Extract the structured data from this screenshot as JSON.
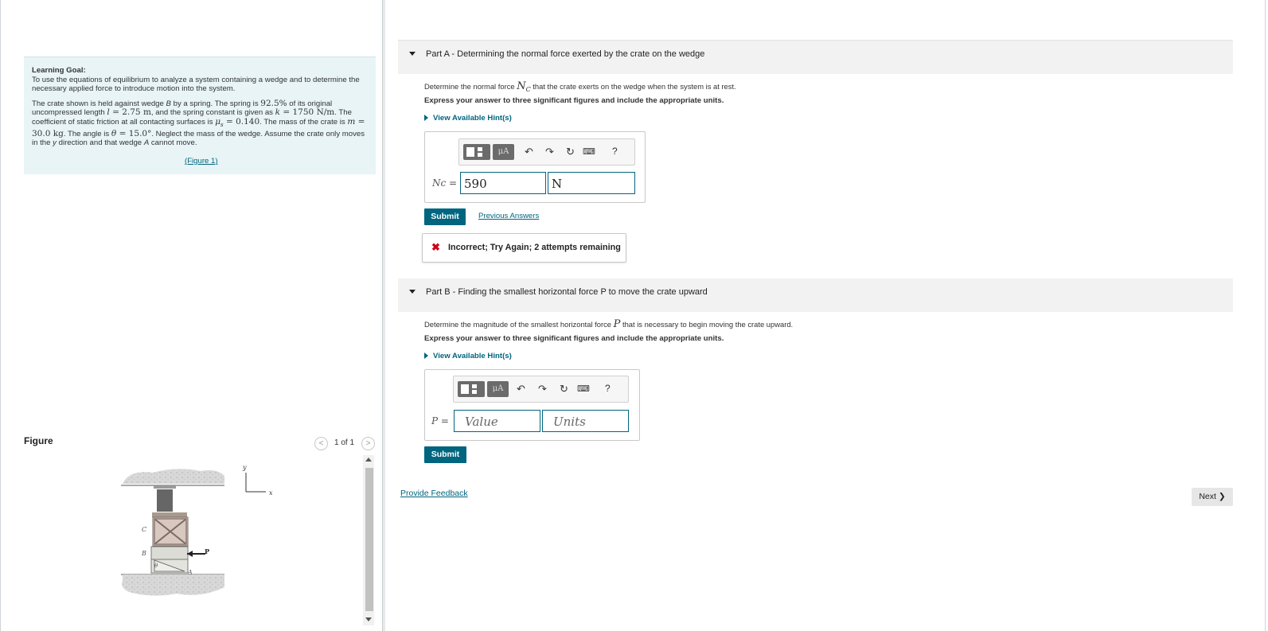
{
  "learning_goal": {
    "title": "Learning Goal:",
    "text": "To use the equations of equilibrium to analyze a system containing a wedge and to determine the necessary applied force to introduce motion into the system.",
    "p1": "The crate shown is held against wedge ",
    "b_label": "B",
    "p2": " by a spring. The spring is ",
    "pct": "92.5%",
    "p3": " of its original uncompressed length ",
    "l_sym": "l",
    "l_val": " = 2.75 m",
    "p4": ", and the spring constant is given as ",
    "k_sym": "k",
    "k_val": " = 1750 N/m",
    "p5": ". The coefficient of static friction at all contacting surfaces is ",
    "mu_sym": "μ",
    "mu_sub": "s",
    "mu_val": " = 0.140",
    "p6": ". The mass of the crate is ",
    "m_sym": "m",
    "m_val": " = 30.0 kg",
    "p7": ". The angle is ",
    "theta_sym": "θ",
    "theta_val": " = 15.0°",
    "p8": ". Neglect the mass of the wedge. Assume the crate only moves in the ",
    "y_label": "y",
    "p9": " direction and that wedge ",
    "a_label": "A",
    "p10": " cannot move.",
    "figure_link": "(Figure 1)"
  },
  "figure": {
    "label": "Figure",
    "pager": "1 of 1",
    "prev_glyph": "<",
    "next_glyph": ">",
    "labels": {
      "y": "y",
      "x": "x",
      "c": "C",
      "b": "B",
      "p": "P",
      "a": "A",
      "theta": "θ"
    }
  },
  "part_a": {
    "title": "Part A - Determining the normal force exerted by the crate on the wedge",
    "q_prefix": "Determine the normal force ",
    "q_sym": "N",
    "q_sub": "C",
    "q_suffix": " that the crate exerts on the wedge when the system is at rest.",
    "instruction": "Express your answer to three significant figures and include the appropriate units.",
    "hint": "View Available Hint(s)",
    "var_label": "Nc =",
    "value": "590",
    "units": "N",
    "submit": "Submit",
    "previous_answers": "Previous Answers",
    "feedback": "Incorrect; Try Again; 2 attempts remaining"
  },
  "part_b": {
    "title": "Part B - Finding the smallest horizontal force P to move the crate upward",
    "q_prefix": "Determine the magnitude of the smallest horizontal force ",
    "q_sym": "P",
    "q_suffix": " that is necessary to begin moving the crate upward.",
    "instruction": "Express your answer to three significant figures and include the appropriate units.",
    "hint": "View Available Hint(s)",
    "var_label": "P =",
    "value_placeholder": "Value",
    "units_placeholder": "Units",
    "submit": "Submit"
  },
  "toolbar": {
    "mu_label": "μA",
    "help": "?"
  },
  "footer": {
    "provide_feedback": "Provide Feedback",
    "next": "Next ❯"
  },
  "colors": {
    "accent": "#00657f",
    "goal_bg": "#e8f4f6",
    "error": "#d0021b"
  }
}
